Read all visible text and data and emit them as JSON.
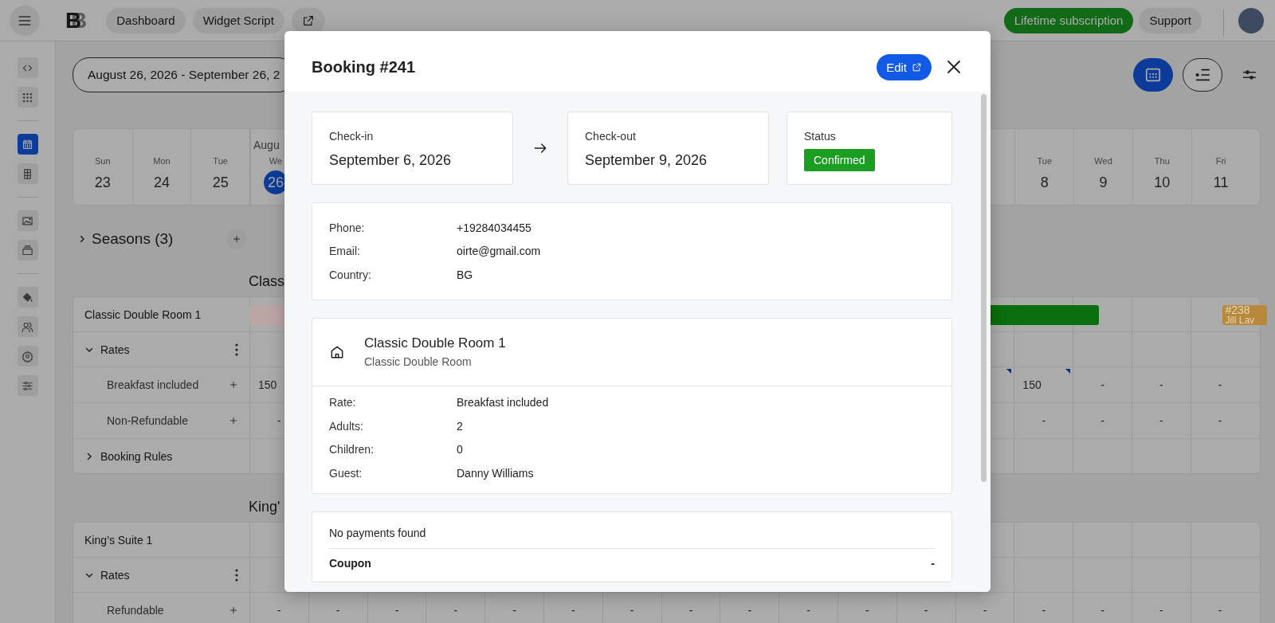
{
  "topbar": {
    "logo": "B",
    "nav": [
      "Dashboard",
      "Widget Script"
    ],
    "subscription": "Lifetime subscription",
    "support": "Support"
  },
  "sidebar": {
    "groups": [
      {
        "items": [
          {
            "kind": "code",
            "selected": false
          },
          {
            "kind": "apps",
            "selected": false
          }
        ]
      },
      {
        "items": [
          {
            "kind": "calendar",
            "selected": true
          },
          {
            "kind": "building",
            "selected": false
          }
        ]
      },
      {
        "items": [
          {
            "kind": "image",
            "selected": false
          },
          {
            "kind": "tray",
            "selected": false
          }
        ]
      },
      {
        "items": [
          {
            "kind": "paint",
            "selected": false
          },
          {
            "kind": "users",
            "selected": false
          },
          {
            "kind": "gear",
            "selected": false
          },
          {
            "kind": "sliders",
            "selected": false
          }
        ]
      }
    ]
  },
  "toolbar": {
    "date_range": "August 26, 2026 - September 26, 2",
    "views": [
      {
        "kind": "calendar",
        "selected": true
      },
      {
        "kind": "list",
        "selected": false
      }
    ]
  },
  "calendar": {
    "month": "Augu",
    "lead_days": [
      {
        "dow": "Sun",
        "date": "23",
        "today": false
      },
      {
        "dow": "Mon",
        "date": "24",
        "today": false
      },
      {
        "dow": "Tue",
        "date": "25",
        "today": false
      }
    ],
    "days": [
      {
        "dow": "We",
        "date": "26",
        "today": true
      }
    ],
    "end_days": [
      {
        "dow": "Tue",
        "date": "8",
        "today": false
      },
      {
        "dow": "Wed",
        "date": "9",
        "today": false
      },
      {
        "dow": "Thu",
        "date": "10",
        "today": false
      },
      {
        "dow": "Fri",
        "date": "11",
        "today": false
      }
    ]
  },
  "seasons": {
    "label": "Seasons (3)",
    "expanded": false
  },
  "sections": [
    {
      "title": "Class",
      "rows": [
        {
          "kind": "room",
          "label": "Classic Double Room 1",
          "bookings": [
            {
              "color": "#bba6a6"
            },
            {
              "color": "#0a6e0c"
            },
            {
              "color": "#b8893b",
              "number": "#238",
              "guest": "Jill Lav"
            }
          ]
        },
        {
          "kind": "rates",
          "label": "Rates",
          "expanded": true
        },
        {
          "kind": "rate",
          "label": "Breakfast included",
          "cells": [
            {
              "text": "150",
              "kind": "price"
            }
          ],
          "end_cells": [
            {
              "flagged": true
            },
            {
              "text": "150",
              "kind": "price",
              "flagged": true
            },
            {
              "text": "-",
              "kind": "empty",
              "flagged": false
            },
            {
              "text": "-",
              "kind": "empty",
              "flagged": false
            },
            {
              "text": "-",
              "kind": "empty",
              "flagged": false
            }
          ]
        },
        {
          "kind": "rate",
          "label": "Non-Refundable",
          "cells": [
            {
              "text": "-",
              "kind": "empty"
            }
          ],
          "end_cells": [
            {
              "text": "-",
              "kind": "empty",
              "flagged": false
            },
            {
              "text": "-",
              "kind": "empty",
              "flagged": false
            },
            {
              "text": "-",
              "kind": "empty",
              "flagged": false
            },
            {
              "text": "-",
              "kind": "empty",
              "flagged": false
            }
          ]
        },
        {
          "kind": "rules",
          "label": "Booking Rules",
          "expanded": false
        }
      ]
    },
    {
      "title": "King'",
      "rows": [
        {
          "kind": "room",
          "label": "King’s Suite 1"
        },
        {
          "kind": "rates",
          "label": "Rates",
          "expanded": true
        },
        {
          "kind": "rate",
          "label": "Refundable",
          "cells": [
            {
              "text": "-",
              "kind": "empty",
              "flagged": false
            },
            {
              "text": "-",
              "kind": "empty",
              "flagged": false
            },
            {
              "text": "-",
              "kind": "empty",
              "flagged": false
            },
            {
              "text": "-",
              "kind": "empty",
              "flagged": false
            },
            {
              "text": "-",
              "kind": "empty",
              "flagged": false
            },
            {
              "text": "-",
              "kind": "empty",
              "flagged": false
            },
            {
              "text": "-",
              "kind": "empty",
              "flagged": false
            },
            {
              "text": "-",
              "kind": "empty",
              "flagged": false
            },
            {
              "text": "-",
              "kind": "empty",
              "flagged": false
            },
            {
              "text": "-",
              "kind": "empty",
              "flagged": false
            },
            {
              "text": "-",
              "kind": "empty",
              "flagged": false
            },
            {
              "text": "-",
              "kind": "empty",
              "flagged": false
            },
            {
              "text": "-",
              "kind": "empty",
              "flagged": false
            },
            {
              "text": "-",
              "kind": "empty",
              "flagged": false
            },
            {
              "text": "-",
              "kind": "empty",
              "flagged": false
            },
            {
              "text": "-",
              "kind": "empty",
              "flagged": false
            },
            {
              "text": "-",
              "kind": "empty",
              "flagged": false
            }
          ]
        }
      ]
    }
  ],
  "booking": {
    "title": "Booking #241",
    "edit": "Edit",
    "checkin": {
      "label": "Check-in",
      "value": "September 6, 2026"
    },
    "checkout": {
      "label": "Check-out",
      "value": "September 9, 2026"
    },
    "status": {
      "label": "Status",
      "value": "Confirmed",
      "kind": "confirmed"
    },
    "contact": [
      {
        "label": "Phone:",
        "value": "+19284034455"
      },
      {
        "label": "Email:",
        "value": "oirte@gmail.com"
      },
      {
        "label": "Country:",
        "value": "BG"
      }
    ],
    "room": {
      "name": "Classic Double Room 1",
      "type": "Classic Double Room",
      "details": [
        {
          "label": "Rate:",
          "value": "Breakfast included"
        },
        {
          "label": "Adults:",
          "value": "2"
        },
        {
          "label": "Children:",
          "value": "0"
        },
        {
          "label": "Guest:",
          "value": "Danny Williams"
        }
      ]
    },
    "payments": {
      "message": "No payments found",
      "coupon_label": "Coupon",
      "coupon_value": "-"
    }
  }
}
